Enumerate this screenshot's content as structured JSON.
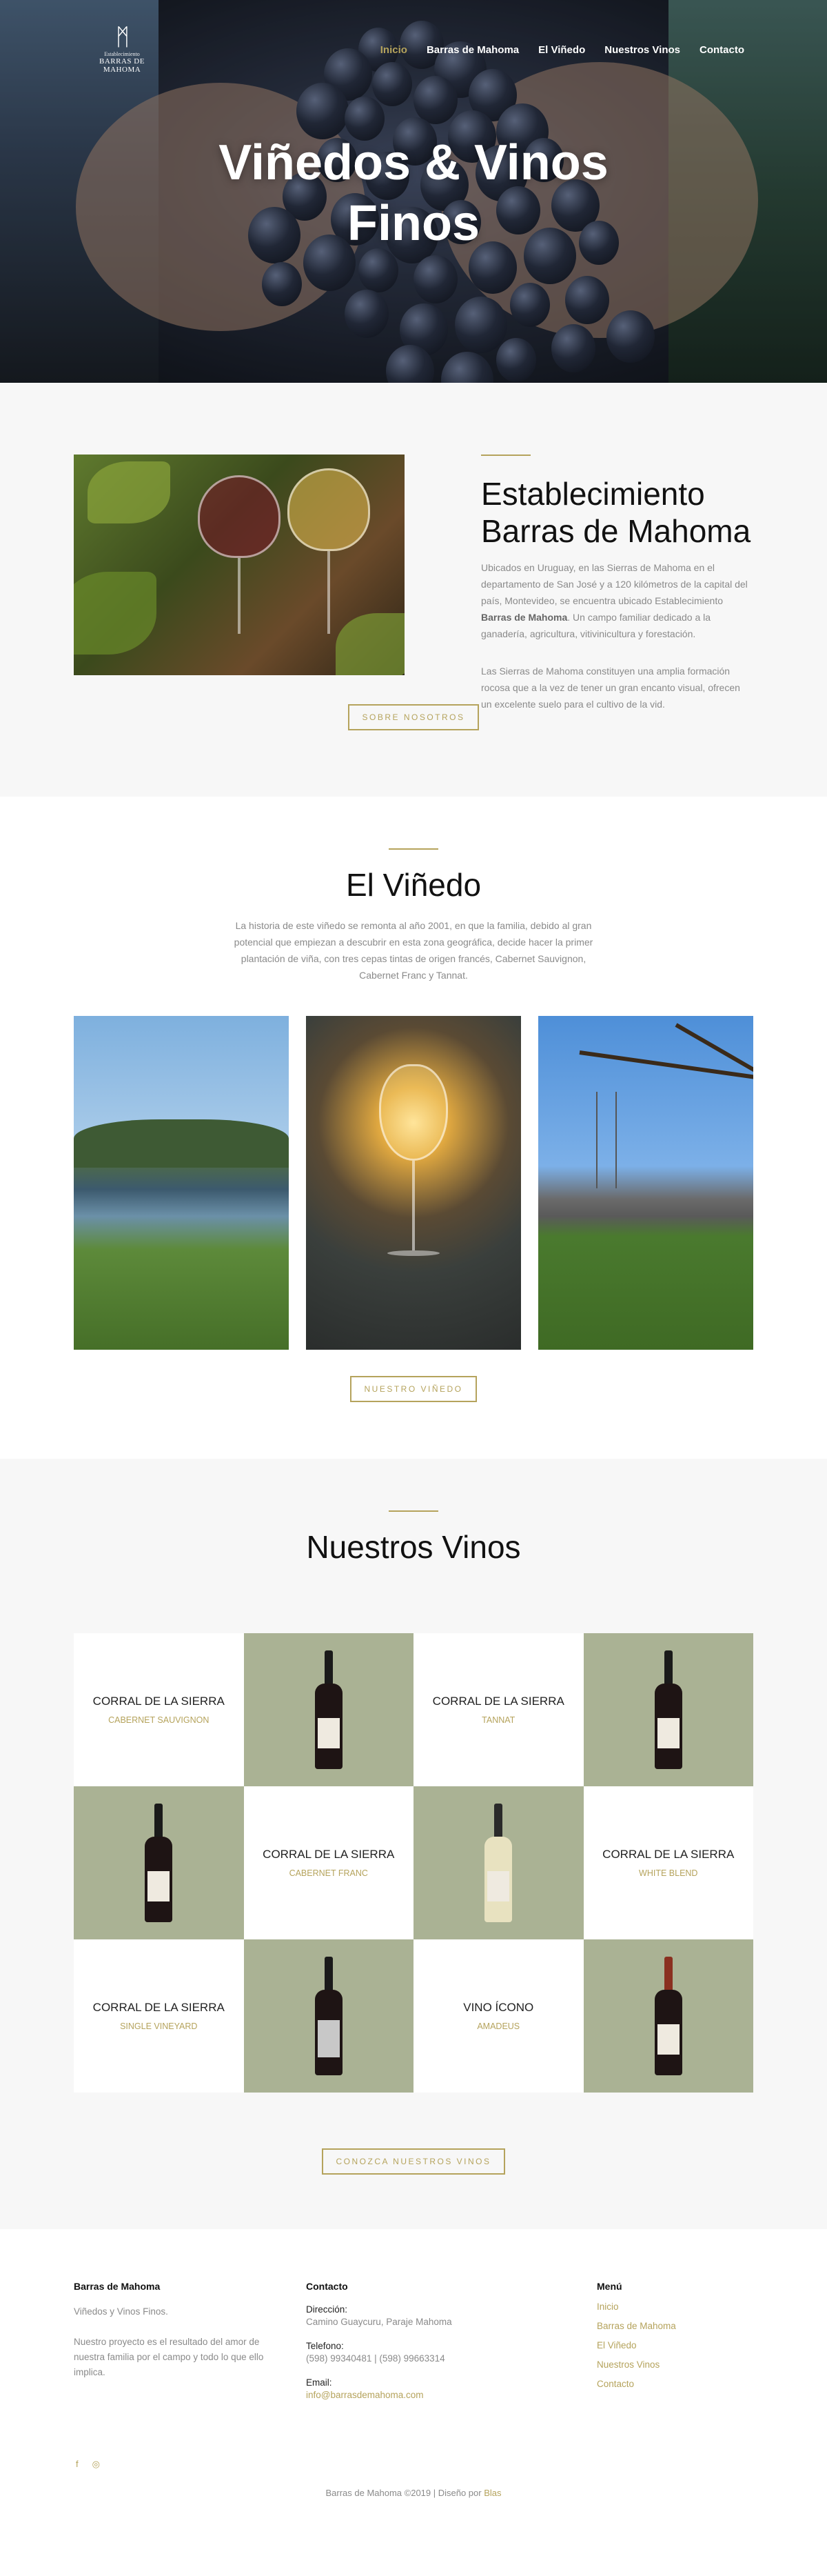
{
  "logo": {
    "small": "Establecimiento",
    "big": "BARRAS DE MAHOMA"
  },
  "nav": [
    {
      "label": "Inicio"
    },
    {
      "label": "Barras de Mahoma"
    },
    {
      "label": "El Viñedo"
    },
    {
      "label": "Nuestros Vinos"
    },
    {
      "label": "Contacto"
    }
  ],
  "hero": {
    "title_line1": "Viñedos & Vinos",
    "title_line2": "Finos"
  },
  "about": {
    "title_line1": "Establecimiento",
    "title_line2": "Barras de Mahoma",
    "p1_before": "Ubicados en Uruguay, en las Sierras de Mahoma en el departamento de San José y a 120 kilómetros de la capital del país, Montevideo, se encuentra ubicado Establecimiento ",
    "p1_bold": "Barras de Mahoma",
    "p1_after": ". Un campo familiar dedicado a la ganadería, agricultura, vitivinicultura y forestación.",
    "p2": "Las Sierras de Mahoma constituyen una amplia formación rocosa que a la vez de tener un gran encanto visual, ofrecen un excelente suelo para el cultivo de la vid.",
    "button": "SOBRE NOSOTROS"
  },
  "vineyard": {
    "title": "El Viñedo",
    "text": "La historia de este viñedo se remonta al año 2001, en que la familia, debido al gran potencial que empiezan a descubrir en esta zona geográfica, decide hacer la primer plantación de viña, con tres cepas tintas de origen francés, Cabernet Sauvignon, Cabernet Franc y Tannat.",
    "button": "NUESTRO VIÑEDO"
  },
  "wines": {
    "title": "Nuestros Vinos",
    "items": [
      {
        "name": "CORRAL DE LA SIERRA",
        "variety": "CABERNET SAUVIGNON"
      },
      {
        "name": "CORRAL DE LA SIERRA",
        "variety": "TANNAT"
      },
      {
        "name": "CORRAL DE LA SIERRA",
        "variety": "CABERNET FRANC"
      },
      {
        "name": "CORRAL DE LA SIERRA",
        "variety": "WHITE BLEND"
      },
      {
        "name": "CORRAL DE LA SIERRA",
        "variety": "SINGLE VINEYARD"
      },
      {
        "name": "VINO ÍCONO",
        "variety": "AMADEUS"
      }
    ],
    "button": "CONOZCA NUESTROS VINOS"
  },
  "footer": {
    "col1_title": "Barras de Mahoma",
    "col1_line": "Viñedos y Vinos Finos.",
    "col1_text": "Nuestro proyecto es el resultado del amor de nuestra familia por el campo y todo lo que ello implica.",
    "col2_title": "Contacto",
    "address_label": "Dirección:",
    "address": "Camino Guaycuru, Paraje Mahoma",
    "phone_label": "Telefono:",
    "phone": "(598) 99340481 | (598) 99663314",
    "email_label": "Email:",
    "email": "info@barrasdemahoma.com",
    "col3_title": "Menú",
    "menu": [
      "Inicio",
      "Barras de Mahoma",
      "El Viñedo",
      "Nuestros Vinos",
      "Contacto"
    ],
    "copyright": "Barras de Mahoma ©2019 | Diseño por ",
    "credit": "Blas"
  },
  "colors": {
    "gold": "#b5a35c",
    "sage": "#aab294",
    "light_bg": "#f7f7f7"
  },
  "icons": [
    "facebook-icon",
    "instagram-icon"
  ]
}
